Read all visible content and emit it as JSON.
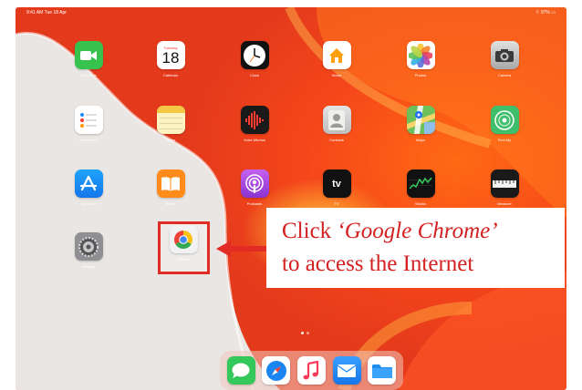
{
  "status_bar": {
    "time": "9:41 AM  Tue 18 Apr",
    "right": "⌔ 97% ▭"
  },
  "apps": [
    {
      "id": "facetime",
      "label": "FaceTime",
      "icon": "video-camera-icon",
      "color": "#37c24e"
    },
    {
      "id": "calendar",
      "label": "Calendar",
      "icon": "calendar-icon",
      "color": "#ffffff",
      "day_name": "Tuesday",
      "day": "18"
    },
    {
      "id": "clock",
      "label": "Clock",
      "icon": "clock-icon",
      "color": "#111111"
    },
    {
      "id": "home",
      "label": "Home",
      "icon": "house-icon",
      "color": "#ffffff"
    },
    {
      "id": "photos",
      "label": "Photos",
      "icon": "photos-icon",
      "color": "#ffffff"
    },
    {
      "id": "camera",
      "label": "Camera",
      "icon": "camera-icon",
      "color": "#d4d4d4"
    },
    {
      "id": "reminders",
      "label": "Reminders",
      "icon": "list-icon",
      "color": "#ffffff"
    },
    {
      "id": "notes",
      "label": "Notes",
      "icon": "notes-icon",
      "color": "#fdf3c0"
    },
    {
      "id": "voice-memos",
      "label": "Voice Memos",
      "icon": "waveform-icon",
      "color": "#1a1a1a"
    },
    {
      "id": "contacts",
      "label": "Contacts",
      "icon": "person-icon",
      "color": "#cfcfcf"
    },
    {
      "id": "maps",
      "label": "Maps",
      "icon": "map-icon",
      "color": "#6cc05c"
    },
    {
      "id": "find-my",
      "label": "Find My",
      "icon": "radar-icon",
      "color": "#3fbf6c"
    },
    {
      "id": "app-store",
      "label": "App Store",
      "icon": "app-store-icon",
      "color": "#1b8cf4"
    },
    {
      "id": "books",
      "label": "Books",
      "icon": "book-icon",
      "color": "#ff8c1a"
    },
    {
      "id": "podcasts",
      "label": "Podcasts",
      "icon": "podcast-icon",
      "color": "#9a44d8"
    },
    {
      "id": "tv",
      "label": "TV",
      "icon": "apple-tv-icon",
      "color": "#111111",
      "glyph": "tv"
    },
    {
      "id": "stocks",
      "label": "Stocks",
      "icon": "chart-icon",
      "color": "#111111"
    },
    {
      "id": "measure",
      "label": "Measure",
      "icon": "ruler-icon",
      "color": "#1a1a1a"
    },
    {
      "id": "settings",
      "label": "Settings",
      "icon": "gear-icon",
      "color": "#8e8e93"
    },
    {
      "id": "chrome",
      "label": "Chrome",
      "icon": "chrome-icon",
      "color": "#f2f2f2"
    }
  ],
  "callout": {
    "prefix": "Click ",
    "app_name": "‘Google Chrome’",
    "line2": "to access the Internet",
    "color": "#d32020"
  },
  "dock": [
    {
      "id": "messages",
      "icon": "message-icon",
      "color": "#34c759"
    },
    {
      "id": "safari",
      "icon": "compass-icon",
      "color": "#1a84f0"
    },
    {
      "id": "music",
      "icon": "music-note-icon",
      "color": "#fa3c5a"
    },
    {
      "id": "mail",
      "icon": "mail-icon",
      "color": "#1e8cf5"
    },
    {
      "id": "files",
      "icon": "folder-icon",
      "color": "#1c8ef0"
    }
  ]
}
